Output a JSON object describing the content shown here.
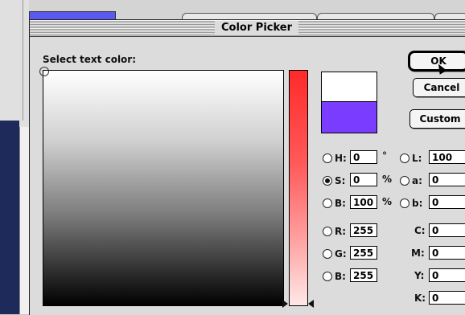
{
  "dialog": {
    "title": "Color Picker",
    "prompt": "Select text color:"
  },
  "buttons": {
    "ok": "OK",
    "cancel": "Cancel",
    "custom": "Custom"
  },
  "swatches": {
    "new_color": "#ffffff",
    "original_color": "#7a3cff"
  },
  "hsb": {
    "h_label": "H:",
    "h_value": "0",
    "h_unit": "°",
    "s_label": "S:",
    "s_value": "0",
    "s_unit": "%",
    "b_label": "B:",
    "b_value": "100",
    "b_unit": "%",
    "selected": "S"
  },
  "lab": {
    "l_label": "L:",
    "l_value": "100",
    "a_label": "a:",
    "a_value": "0",
    "b_label": "b:",
    "b_value": "0"
  },
  "rgb": {
    "r_label": "R:",
    "r_value": "255",
    "g_label": "G:",
    "g_value": "255",
    "b_label": "B:",
    "b_value": "255"
  },
  "cmyk": {
    "c_label": "C:",
    "c_value": "0",
    "m_label": "M:",
    "m_value": "0",
    "y_label": "Y:",
    "y_value": "0",
    "k_label": "K:",
    "k_value": "0"
  }
}
